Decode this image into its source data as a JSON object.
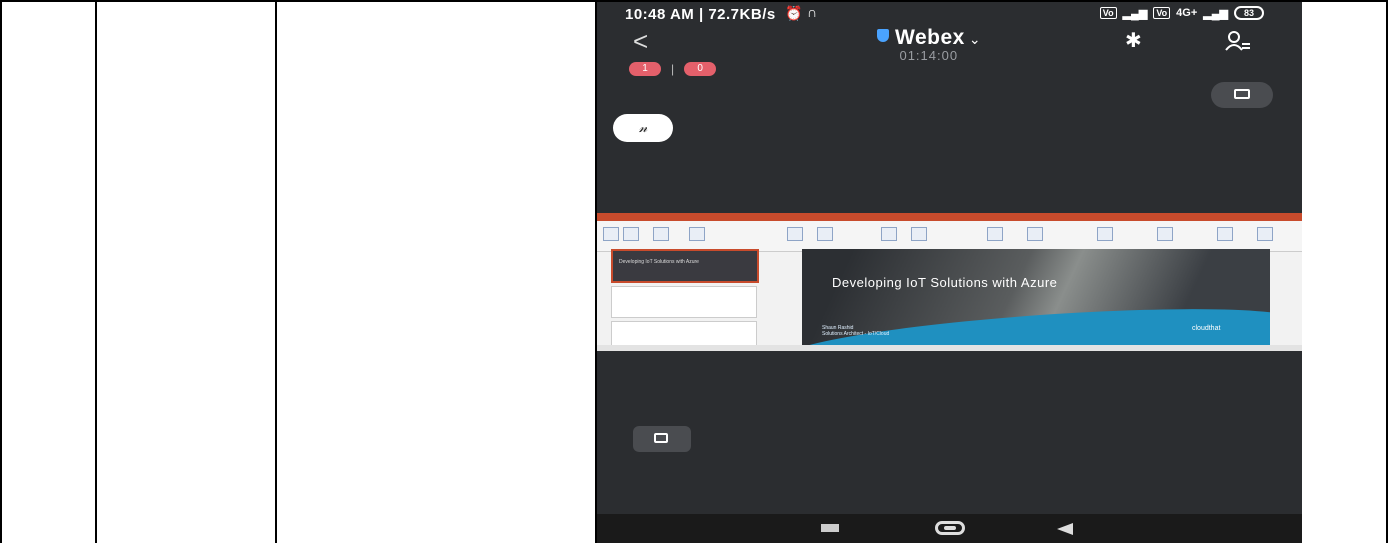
{
  "statusbar": {
    "time_speed": "10:48 AM | 72.7KB/s",
    "signal_a": "Vo",
    "signal_b": "Vo",
    "lte": "4G+",
    "battery": "83"
  },
  "header": {
    "title": "Webex",
    "timer": "01:14:00"
  },
  "badges": {
    "first": "1",
    "second": "0"
  },
  "annotate_glyph": "𝓃",
  "presentation": {
    "slide_title": "Developing IoT Solutions with Azure",
    "thumb_title": "Developing IoT Solutions with Azure",
    "author_line1": "Shaun Rashid",
    "author_line2": "Solutions Architect - IoT/Cloud",
    "logo": "cloudthat"
  },
  "icons": [
    "back-icon",
    "shield-icon",
    "chevron-down-icon",
    "bluetooth-icon",
    "participants-icon",
    "layout-icon",
    "annotate-icon",
    "share-screen-icon",
    "recent-apps-icon",
    "home-icon",
    "nav-back-icon"
  ]
}
